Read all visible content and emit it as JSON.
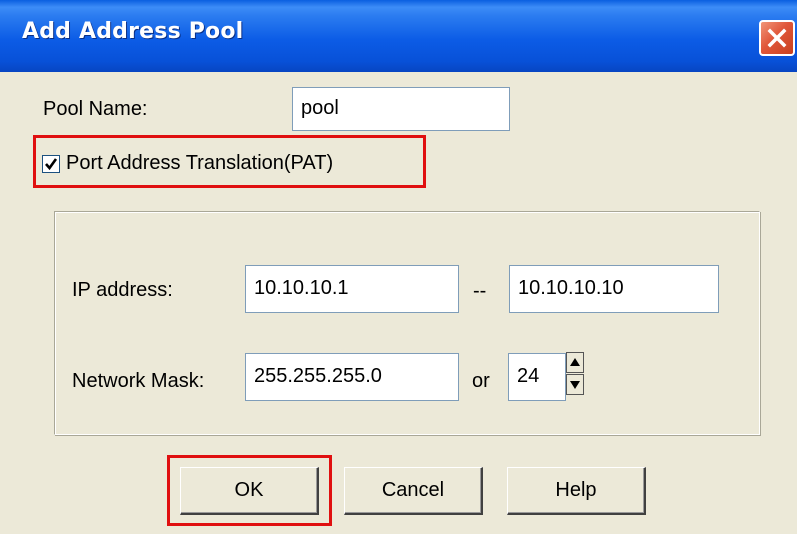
{
  "window": {
    "title": "Add Address Pool"
  },
  "icons": {
    "close": "close-icon",
    "check": "checkmark-icon",
    "spin_up": "arrow-up-icon",
    "spin_down": "arrow-down-icon"
  },
  "colors": {
    "titlebar": "#0c5ce6",
    "highlight_box": "#e01010",
    "dialog_bg": "#ece9d8"
  },
  "form": {
    "pool_name_label": "Pool Name:",
    "pool_name_value": "pool",
    "pat_label": "Port Address Translation(PAT)",
    "pat_checked": true,
    "ip_address_label": "IP address:",
    "ip_start_value": "10.10.10.1",
    "range_separator": "--",
    "ip_end_value": "10.10.10.10",
    "network_mask_label": "Network Mask:",
    "network_mask_value": "255.255.255.0",
    "or_label": "or",
    "prefix_value": "24"
  },
  "buttons": {
    "ok": "OK",
    "cancel": "Cancel",
    "help": "Help"
  }
}
